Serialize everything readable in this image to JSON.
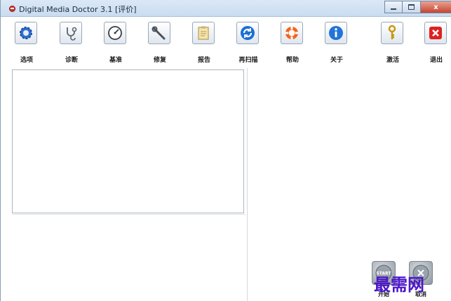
{
  "window": {
    "title": "Digital Media Doctor 3.1 [评价]",
    "controls": {
      "minimize": "minimize",
      "maximize": "maximize",
      "close": "x"
    }
  },
  "toolbar": {
    "items": [
      {
        "label": "选项",
        "icon": "gear-icon"
      },
      {
        "label": "诊断",
        "icon": "stethoscope-icon"
      },
      {
        "label": "基准",
        "icon": "gauge-icon"
      },
      {
        "label": "修复",
        "icon": "wrench-icon"
      },
      {
        "label": "报告",
        "icon": "clipboard-icon"
      },
      {
        "label": "再扫描",
        "icon": "refresh-icon"
      },
      {
        "label": "帮助",
        "icon": "lifebuoy-icon"
      },
      {
        "label": "关于",
        "icon": "info-icon"
      },
      {
        "label": "激活",
        "icon": "key-icon"
      },
      {
        "label": "退出",
        "icon": "exit-icon"
      }
    ]
  },
  "actions": {
    "start_label": "开始",
    "start_icon_text": "START",
    "cancel_label": "取消"
  },
  "watermark": "最需网",
  "colors": {
    "accent": "#1e6fd6",
    "exit": "#e02020",
    "watermark": "#4b16c8"
  }
}
